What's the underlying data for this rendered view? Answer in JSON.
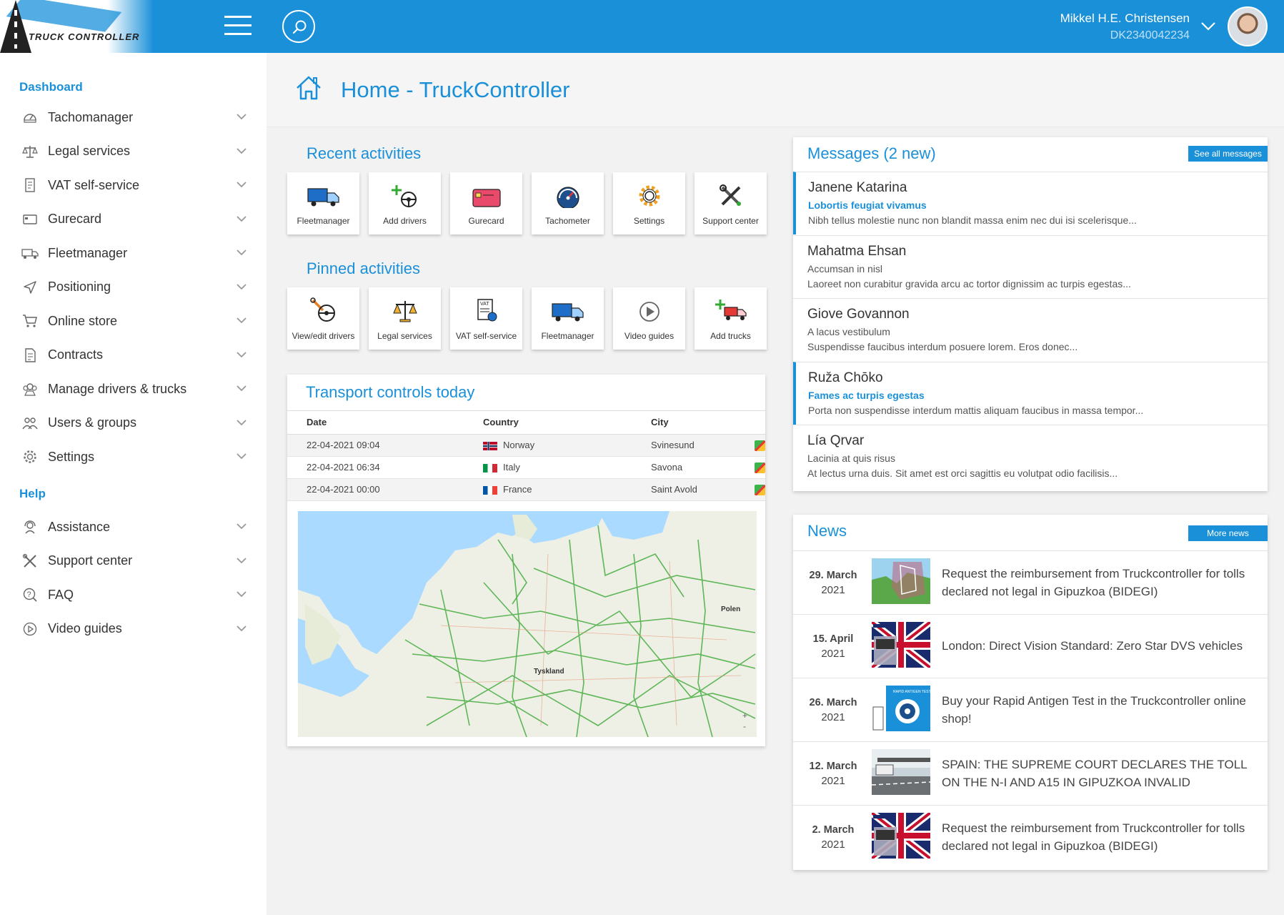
{
  "header": {
    "logo_text": "TRUCK CONTROLLER",
    "user_name": "Mikkel H.E. Christensen",
    "user_id": "DK2340042234"
  },
  "sidebar": {
    "sections": [
      {
        "label": "Dashboard"
      },
      {
        "label": "Help"
      }
    ],
    "dashboard_items": [
      {
        "label": "Tachomanager",
        "icon": "speedometer-icon"
      },
      {
        "label": "Legal services",
        "icon": "scales-icon"
      },
      {
        "label": "VAT self-service",
        "icon": "document-icon"
      },
      {
        "label": "Gurecard",
        "icon": "card-icon"
      },
      {
        "label": "Fleetmanager",
        "icon": "truck-icon"
      },
      {
        "label": "Positioning",
        "icon": "navigation-icon"
      },
      {
        "label": "Online store",
        "icon": "cart-icon"
      },
      {
        "label": "Contracts",
        "icon": "contract-icon"
      },
      {
        "label": "Manage drivers & trucks",
        "icon": "drivers-icon"
      },
      {
        "label": "Users & groups",
        "icon": "users-icon"
      },
      {
        "label": "Settings",
        "icon": "gear-icon"
      }
    ],
    "help_items": [
      {
        "label": "Assistance",
        "icon": "headset-icon"
      },
      {
        "label": "Support center",
        "icon": "tools-icon"
      },
      {
        "label": "FAQ",
        "icon": "question-icon"
      },
      {
        "label": "Video guides",
        "icon": "play-icon"
      }
    ]
  },
  "page": {
    "title": "Home - TruckController"
  },
  "recent": {
    "title": "Recent activities",
    "tiles": [
      {
        "label": "Fleetmanager",
        "icon": "truck-icon"
      },
      {
        "label": "Add drivers",
        "icon": "add-driver-icon"
      },
      {
        "label": "Gurecard",
        "icon": "card-icon"
      },
      {
        "label": "Tachometer",
        "icon": "tachometer-icon"
      },
      {
        "label": "Settings",
        "icon": "gear-icon"
      },
      {
        "label": "Support center",
        "icon": "tools-icon"
      }
    ]
  },
  "pinned": {
    "title": "Pinned activities",
    "tiles": [
      {
        "label": "View/edit drivers",
        "icon": "edit-driver-icon"
      },
      {
        "label": "Legal services",
        "icon": "scales-icon"
      },
      {
        "label": "VAT self-service",
        "icon": "vat-document-icon"
      },
      {
        "label": "Fleetmanager",
        "icon": "truck-icon"
      },
      {
        "label": "Video guides",
        "icon": "play-icon"
      },
      {
        "label": "Add trucks",
        "icon": "add-truck-icon"
      }
    ]
  },
  "transport": {
    "title": "Transport controls today",
    "columns": [
      "Date",
      "Country",
      "City"
    ],
    "rows": [
      {
        "date": "22-04-2021 09:04",
        "country": "Norway",
        "city": "Svinesund",
        "flag": "norway"
      },
      {
        "date": "22-04-2021 06:34",
        "country": "Italy",
        "city": "Savona",
        "flag": "italy"
      },
      {
        "date": "22-04-2021 00:00",
        "country": "France",
        "city": "Saint Avold",
        "flag": "france"
      }
    ],
    "map_labels": [
      "Tyskland",
      "Polen"
    ]
  },
  "messages": {
    "title": "Messages (2 new)",
    "see_all": "See all messages",
    "items": [
      {
        "name": "Janene Katarina",
        "subject": "Lobortis feugiat vivamus",
        "body": "Nibh tellus molestie nunc non blandit massa enim nec dui isi scelerisque...",
        "unread": true
      },
      {
        "name": "Mahatma Ehsan",
        "subject": "Accumsan in nisl",
        "body": "Laoreet non curabitur gravida arcu ac tortor dignissim ac turpis egestas...",
        "unread": false
      },
      {
        "name": "Giove Govannon",
        "subject": "A lacus vestibulum",
        "body": "Suspendisse faucibus interdum posuere lorem. Eros donec...",
        "unread": false
      },
      {
        "name": "Ruža Chōko",
        "subject": "Fames ac turpis egestas",
        "body": "Porta non suspendisse interdum mattis aliquam faucibus in massa tempor...",
        "unread": true
      },
      {
        "name": "Lía Qrvar",
        "subject": "Lacinia at quis risus",
        "body": "At lectus urna duis. Sit amet est orci sagittis eu volutpat odio facilisis...",
        "unread": false
      }
    ]
  },
  "news": {
    "title": "News",
    "more": "More news",
    "items": [
      {
        "day": "29. March",
        "year": "2021",
        "text": "Request the reimbursement from Truckcontroller for tolls declared not legal in Gipuzkoa (BIDEGI)",
        "thumb": "map"
      },
      {
        "day": "15. April",
        "year": "2021",
        "text": "London: Direct Vision Standard: Zero Star DVS vehicles",
        "thumb": "flag-truck"
      },
      {
        "day": "26. March",
        "year": "2021",
        "text": "Buy your Rapid Antigen Test in the Truckcontroller online shop!",
        "thumb": "virus"
      },
      {
        "day": "12. March",
        "year": "2021",
        "text": "SPAIN: THE SUPREME COURT DECLARES THE TOLL ON THE N-I AND A15 IN GIPUZKOA INVALID",
        "thumb": "highway"
      },
      {
        "day": "2. March",
        "year": "2021",
        "text": "Request the reimbursement from Truckcontroller for tolls declared not legal in Gipuzkoa (BIDEGI)",
        "thumb": "flag-truck"
      }
    ]
  },
  "colors": {
    "brand": "#1a90d9",
    "background": "#f2f2f2"
  }
}
